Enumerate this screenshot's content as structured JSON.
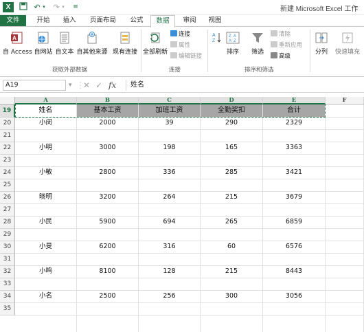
{
  "window": {
    "title": "新建 Microsoft Excel 工作"
  },
  "tabs": [
    "文件",
    "开始",
    "插入",
    "页面布局",
    "公式",
    "数据",
    "审阅",
    "视图"
  ],
  "active_tab": "数据",
  "ribbon": {
    "get_external": {
      "access": "自 Access",
      "web": "自网站",
      "text": "自文本",
      "other": "自其他来源",
      "existing": "现有连接",
      "label": "获取外部数据"
    },
    "connections": {
      "refresh_all": "全部刷新",
      "connections": "连接",
      "properties": "属性",
      "edit_links": "编辑链接",
      "label": "连接"
    },
    "sort_filter": {
      "sort": "排序",
      "filter": "筛选",
      "clear": "清除",
      "reapply": "重新应用",
      "advanced": "高级",
      "label": "排序和筛选"
    },
    "tools": {
      "text_to_columns": "分列",
      "flash_fill": "快速填充"
    }
  },
  "formula_bar": {
    "name_box": "A19",
    "fx": "fx",
    "content": "姓名"
  },
  "columns": [
    "A",
    "B",
    "C",
    "D",
    "E",
    "F"
  ],
  "rows": [
    "19",
    "20",
    "21",
    "22",
    "23",
    "24",
    "25",
    "26",
    "27",
    "28",
    "29",
    "30",
    "31",
    "32",
    "33",
    "34",
    "35"
  ],
  "header_row": [
    "姓名",
    "基本工资",
    "加班工资",
    "全勤奖扣",
    "合计"
  ],
  "data_rows": [
    {
      "row": "20",
      "cells": [
        "小闵",
        "2000",
        "39",
        "290",
        "2329"
      ]
    },
    {
      "row": "22",
      "cells": [
        "小明",
        "3000",
        "198",
        "165",
        "3363"
      ]
    },
    {
      "row": "24",
      "cells": [
        "小敏",
        "2800",
        "336",
        "285",
        "3421"
      ]
    },
    {
      "row": "26",
      "cells": [
        "晓明",
        "3200",
        "264",
        "215",
        "3679"
      ]
    },
    {
      "row": "28",
      "cells": [
        "小民",
        "5900",
        "694",
        "265",
        "6859"
      ]
    },
    {
      "row": "30",
      "cells": [
        "小旻",
        "6200",
        "316",
        "60",
        "6576"
      ]
    },
    {
      "row": "32",
      "cells": [
        "小鸣",
        "8100",
        "128",
        "215",
        "8443"
      ]
    },
    {
      "row": "34",
      "cells": [
        "小名",
        "2500",
        "256",
        "300",
        "3056"
      ]
    }
  ],
  "colors": {
    "accent": "#217346",
    "header_fill": "#a6a6a6"
  }
}
